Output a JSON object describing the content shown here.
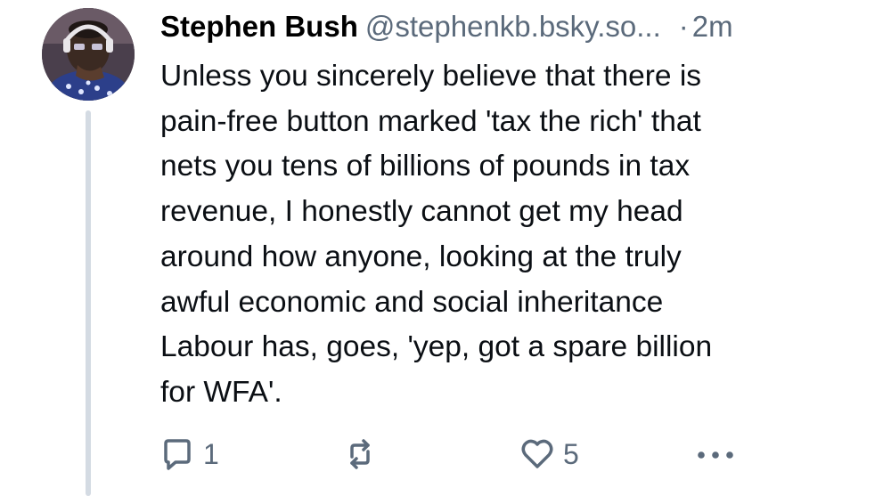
{
  "post": {
    "author_name": "Stephen Bush",
    "author_handle": "@stephenkb.bsky.so...",
    "separator": "·",
    "timestamp": "2m",
    "text_lines": [
      "Unless you sincerely believe that there is",
      "pain-free button marked 'tax the rich' that",
      "nets you tens of billions of pounds in tax",
      "revenue, I honestly cannot get my head",
      "around how anyone, looking at the truly",
      "awful economic and social inheritance",
      "Labour has, goes, 'yep, got a spare billion",
      "for WFA'."
    ],
    "reply_count": "1",
    "like_count": "5"
  },
  "icons": {
    "reply": "reply-icon",
    "repost": "repost-icon",
    "like": "heart-icon",
    "more": "more-icon"
  },
  "colors": {
    "muted": "#5b6a7b",
    "thread_line": "#d4dbe3",
    "text": "#0b0f14"
  }
}
